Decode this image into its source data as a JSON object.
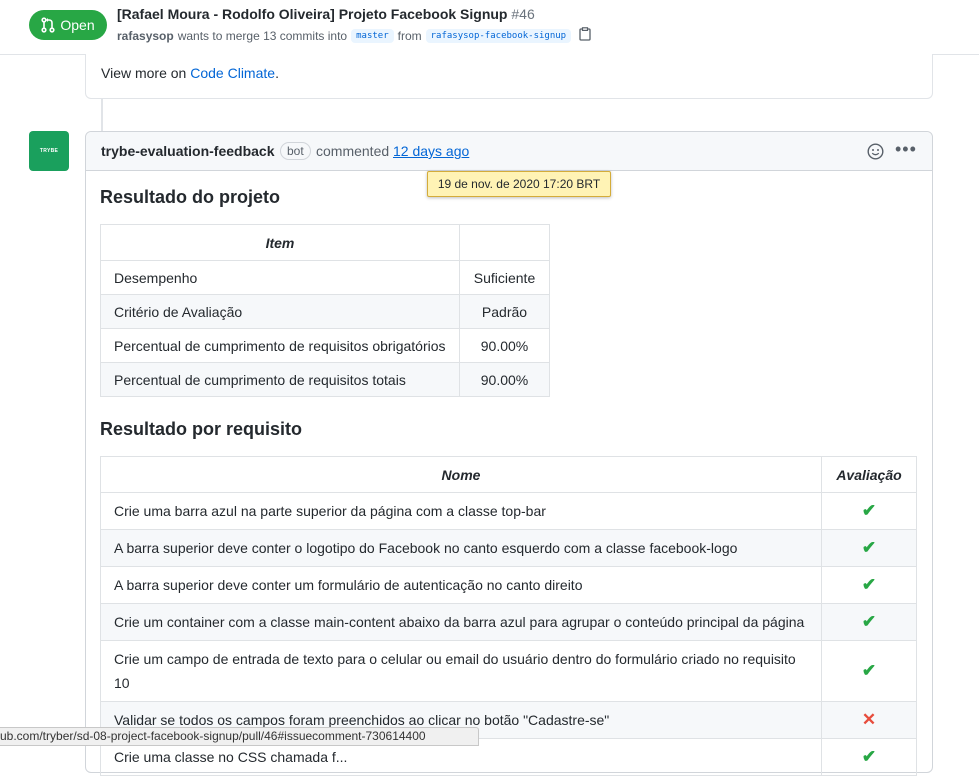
{
  "header": {
    "state": "Open",
    "title": "[Rafael Moura - Rodolfo Oliveira] Projeto Facebook Signup",
    "number": "#46",
    "author": "rafasysop",
    "merge_text": "wants to merge 13 commits into",
    "base_branch": "master",
    "from_text": "from",
    "head_branch": "rafasysop-facebook-signup"
  },
  "prev_comment": {
    "text": "View more on ",
    "link": "Code Climate",
    "suffix": "."
  },
  "comment": {
    "avatar_text": "TRYBE",
    "author": "trybe-evaluation-feedback",
    "bot_label": "bot",
    "action": "commented",
    "time": "12 days ago",
    "tooltip": "19 de nov. de 2020 17:20 BRT"
  },
  "result": {
    "heading": "Resultado do projeto",
    "header": [
      "Item",
      ""
    ],
    "rows": [
      [
        "Desempenho",
        "Suficiente"
      ],
      [
        "Critério de Avaliação",
        "Padrão"
      ],
      [
        "Percentual de cumprimento de requisitos obrigatórios",
        "90.00%"
      ],
      [
        "Percentual de cumprimento de requisitos totais",
        "90.00%"
      ]
    ]
  },
  "requirements": {
    "heading": "Resultado por requisito",
    "header": [
      "Nome",
      "Avaliação"
    ],
    "rows": [
      {
        "name": "Crie uma barra azul na parte superior da página com a classe top-bar",
        "mark": "✔",
        "status": "ok"
      },
      {
        "name": "A barra superior deve conter o logotipo do Facebook no canto esquerdo com a classe facebook-logo",
        "mark": "✔",
        "status": "ok"
      },
      {
        "name": "A barra superior deve conter um formulário de autenticação no canto direito",
        "mark": "✔",
        "status": "ok"
      },
      {
        "name": "Crie um container com a classe main-content abaixo da barra azul para agrupar o conteúdo principal da página",
        "mark": "✔",
        "status": "ok"
      },
      {
        "name": "Crie um campo de entrada de texto para o celular ou email do usuário dentro do formulário criado no requisito 10",
        "mark": "✔",
        "status": "ok"
      },
      {
        "name": "Validar se todos os campos foram preenchidos ao clicar no botão \"Cadastre-se\"",
        "mark": "✕",
        "status": "fail"
      },
      {
        "name": "Crie uma classe no CSS chamada f...",
        "mark": "✔",
        "status": "ok"
      }
    ]
  },
  "status_bar": "ub.com/tryber/sd-08-project-facebook-signup/pull/46#issuecomment-730614400",
  "colors": {
    "open_green": "#28a745",
    "link_blue": "#0366d6",
    "fail_red": "#e74c3c",
    "tooltip_bg": "#fff3b5"
  }
}
